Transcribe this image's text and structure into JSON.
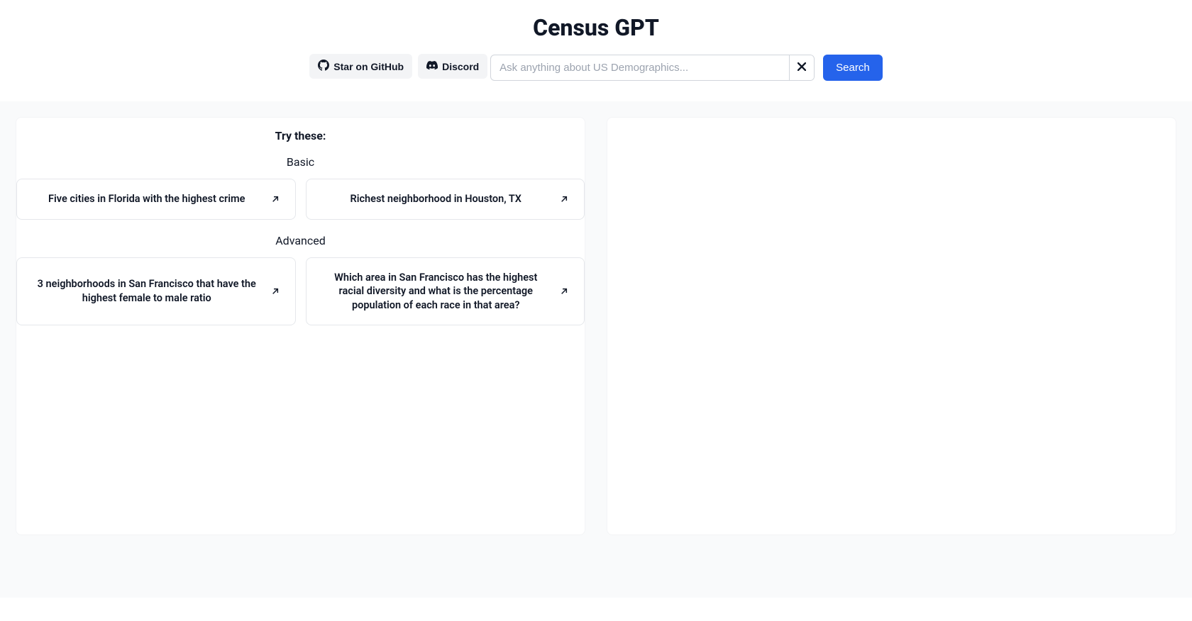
{
  "header": {
    "title": "Census GPT",
    "github_label": "Star on GitHub",
    "discord_label": "Discord"
  },
  "search": {
    "placeholder": "Ask anything about US Demographics...",
    "button_label": "Search"
  },
  "examples": {
    "title": "Try these:",
    "sections": [
      {
        "label": "Basic",
        "items": [
          "Five cities in Florida with the highest crime",
          "Richest neighborhood in Houston, TX"
        ]
      },
      {
        "label": "Advanced",
        "items": [
          "3 neighborhoods in San Francisco that have the highest female to male ratio",
          "Which area in San Francisco has the highest racial diversity and what is the percentage population of each race in that area?"
        ]
      }
    ]
  }
}
